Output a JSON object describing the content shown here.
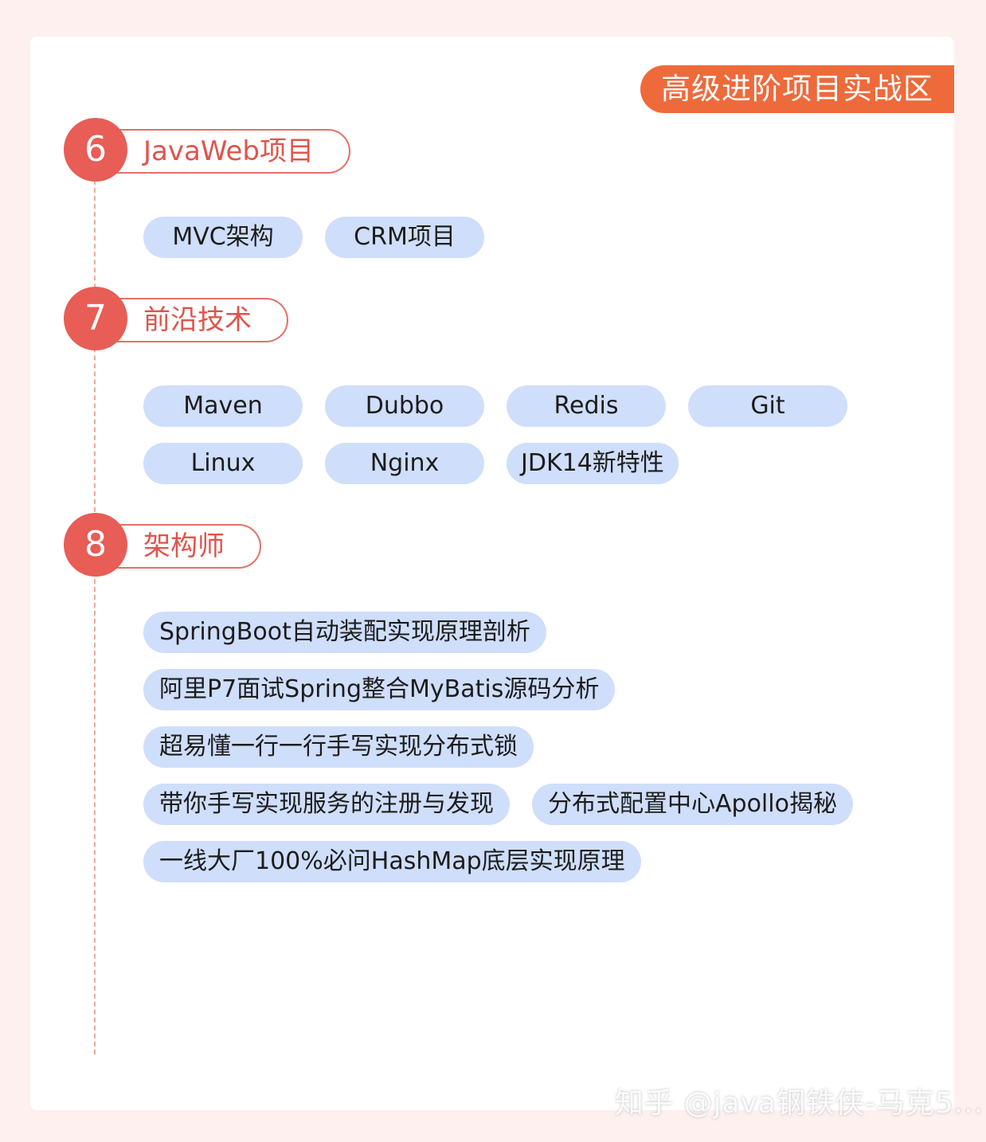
{
  "zone_title": "高级进阶项目实战区",
  "sections": [
    {
      "number": "6",
      "title": "JavaWeb项目",
      "chips": [
        "MVC架构",
        "CRM项目"
      ]
    },
    {
      "number": "7",
      "title": "前沿技术",
      "chips_row1": [
        "Maven",
        "Dubbo",
        "Redis",
        "Git"
      ],
      "chips_row2": [
        "Linux",
        "Nginx",
        "JDK14新特性"
      ]
    },
    {
      "number": "8",
      "title": "架构师",
      "chips": [
        "SpringBoot自动装配实现原理剖析",
        "阿里P7面试Spring整合MyBatis源码分析",
        "超易懂一行一行手写实现分布式锁",
        "带你手写实现服务的注册与发现",
        "分布式配置中心Apollo揭秘",
        "一线大厂100%必问HashMap底层实现原理"
      ]
    }
  ],
  "watermark": "知乎 @java钢铁侠-马克5...",
  "colors": {
    "accent_orange": "#ee6a3b",
    "accent_red": "#e85d55",
    "chip_blue": "#cfdefa"
  }
}
